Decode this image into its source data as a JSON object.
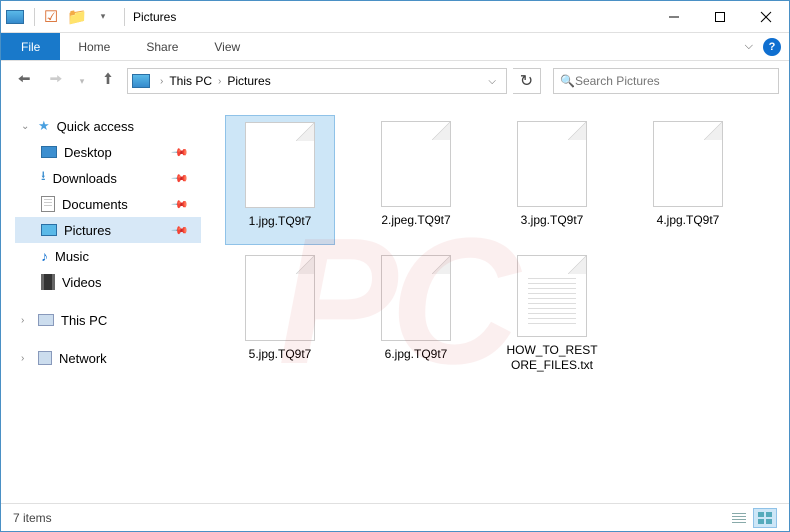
{
  "window": {
    "title": "Pictures"
  },
  "ribbon": {
    "file": "File",
    "tabs": [
      "Home",
      "Share",
      "View"
    ]
  },
  "breadcrumb": {
    "root": "This PC",
    "current": "Pictures"
  },
  "search": {
    "placeholder": "Search Pictures"
  },
  "sidebar": {
    "quick_access": "Quick access",
    "items": [
      {
        "label": "Desktop",
        "pinned": true
      },
      {
        "label": "Downloads",
        "pinned": true
      },
      {
        "label": "Documents",
        "pinned": true
      },
      {
        "label": "Pictures",
        "pinned": true,
        "selected": true
      },
      {
        "label": "Music",
        "pinned": false
      },
      {
        "label": "Videos",
        "pinned": false
      }
    ],
    "this_pc": "This PC",
    "network": "Network"
  },
  "files": [
    {
      "name": "1.jpg.TQ9t7",
      "selected": true,
      "type": "file"
    },
    {
      "name": "2.jpeg.TQ9t7",
      "selected": false,
      "type": "file"
    },
    {
      "name": "3.jpg.TQ9t7",
      "selected": false,
      "type": "file"
    },
    {
      "name": "4.jpg.TQ9t7",
      "selected": false,
      "type": "file"
    },
    {
      "name": "5.jpg.TQ9t7",
      "selected": false,
      "type": "file"
    },
    {
      "name": "6.jpg.TQ9t7",
      "selected": false,
      "type": "file"
    },
    {
      "name": "HOW_TO_RESTORE_FILES.txt",
      "selected": false,
      "type": "txt"
    }
  ],
  "status": {
    "count_label": "7 items"
  }
}
